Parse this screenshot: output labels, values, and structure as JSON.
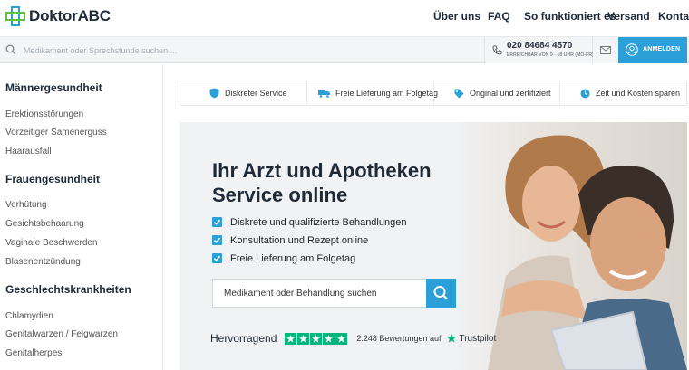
{
  "brand": {
    "name": "DoktorABC"
  },
  "nav": {
    "about": "Über uns",
    "faq": "FAQ",
    "how": "So funktioniert es",
    "shipping": "Versand",
    "contact": "Kontakt"
  },
  "search_top": {
    "placeholder": "Medikament oder Sprechstunde suchen ..."
  },
  "phone": {
    "number": "020 84684 4570",
    "hours": "ERREICHBAR VON 9 - 18 UHR (MO-FR)"
  },
  "login": {
    "label": "ANMELDEN"
  },
  "sidebar": {
    "categories": [
      {
        "title": "Männergesundheit",
        "items": [
          "Erektionsstörungen",
          "Vorzeitiger Samenerguss",
          "Haarausfall"
        ]
      },
      {
        "title": "Frauengesundheit",
        "items": [
          "Verhütung",
          "Gesichtsbehaarung",
          "Vaginale Beschwerden",
          "Blasenentzündung"
        ]
      },
      {
        "title": "Geschlechtskrankheiten",
        "items": [
          "Chlamydien",
          "Genitalwarzen / Feigwarzen",
          "Genitalherpes"
        ]
      }
    ]
  },
  "features": [
    "Diskreter Service",
    "Freie Lieferung am Folgetag",
    "Original und zertifiziert",
    "Zeit und Kosten sparen"
  ],
  "hero": {
    "title_line1": "Ihr Arzt und Apotheken",
    "title_line2": "Service online",
    "checks": [
      "Diskrete und qualifizierte Behandlungen",
      "Konsultation und Rezept online",
      "Freie Lieferung am Folgetag"
    ],
    "search_placeholder": "Medikament oder Behandlung suchen"
  },
  "trustpilot": {
    "rating_label": "Hervorragend",
    "stars": 5,
    "count": "2.248",
    "reviews_label": "Bewertungen auf",
    "brand": "Trustpilot"
  },
  "colors": {
    "accent": "#2b9fd7",
    "trustpilot_green": "#00b67a",
    "heading": "#1e2a38"
  },
  "icons": [
    "logo-cross-icon",
    "search-icon",
    "phone-icon",
    "mail-icon",
    "user-icon",
    "shield-icon",
    "truck-icon",
    "tag-icon",
    "clock-icon",
    "check-icon",
    "star-icon"
  ]
}
